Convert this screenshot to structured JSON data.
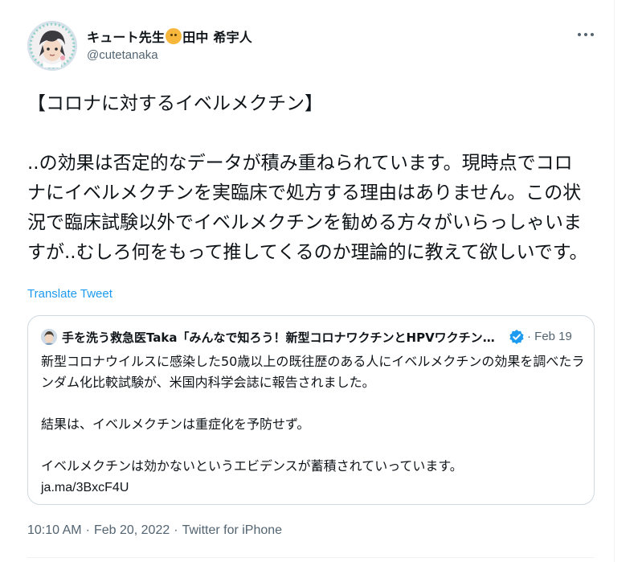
{
  "author": {
    "name_part1": "キュート先生",
    "emoji": "hugging-face-emoji",
    "name_part2": "田中 希宇人",
    "handle": "@cutetanaka"
  },
  "tweet": {
    "body": "【コロナに対するイベルメクチン】\n\n..の効果は否定的なデータが積み重ねられています。現時点でコロナにイベルメクチンを実臨床で処方する理由はありません。この状況で臨床試験以外でイベルメクチンを勧める方々がいらっしゃいますが..むしろ何をもって推してくるのか理論的に教えて欲しいです。",
    "translate_label": "Translate Tweet",
    "time": "10:10 AM",
    "date": "Feb 20, 2022",
    "source": "Twitter for iPhone",
    "separator": "·"
  },
  "quoted_tweet": {
    "name": "手を洗う救急医Taka「みんなで知ろう！新型コロナワクチンとHPVワクチンの大切な話」",
    "verified": true,
    "separator": "·",
    "date": "Feb 19",
    "text": "新型コロナウイルスに感染した50歳以上の既往歴のある人にイベルメクチンの効果を調べたランダム化比較試験が、米国内科学会誌に報告されました。\n\n結果は、イベルメクチンは重症化を予防せず。\n\nイベルメクチンは効かないというエビデンスが蓄積されていっています。",
    "link": "ja.ma/3BxcF4U"
  },
  "more_icon": "more-horizontal-icon",
  "colors": {
    "link": "#1d9bf0",
    "secondary_text": "#536471",
    "border": "#cfd9de",
    "verified": "#1d9bf0"
  }
}
